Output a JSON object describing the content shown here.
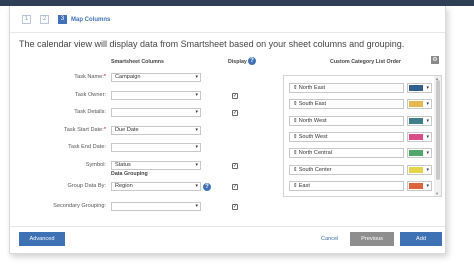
{
  "wizard": {
    "steps": [
      "1",
      "2",
      "3"
    ],
    "current_step_title": "Map Columns"
  },
  "intro_text": "The calendar view will display data from Smartsheet based on your sheet columns and grouping.",
  "columns_header": "Smartsheet Columns",
  "display_header": "Display",
  "category_header": "Custom Category List Order",
  "help_glyph": "?",
  "fields": [
    {
      "label": "Task Name:",
      "required": true,
      "value": "Campaign",
      "display": null
    },
    {
      "label": "Task Owner:",
      "required": false,
      "value": "",
      "display": true
    },
    {
      "label": "Task Details:",
      "required": false,
      "value": "",
      "display": true
    },
    {
      "label": "Task Start Date:",
      "required": true,
      "value": "Due Date",
      "display": null
    },
    {
      "label": "Task End Date:",
      "required": false,
      "value": "",
      "display": null
    },
    {
      "label": "Symbol:",
      "required": false,
      "value": "Status",
      "display": true
    }
  ],
  "data_grouping": {
    "title": "Data Grouping",
    "fields": [
      {
        "label": "Group Data By:",
        "value": "Region",
        "display": true,
        "help": true
      },
      {
        "label": "Secondary Grouping:",
        "value": "",
        "display": true,
        "help": false
      }
    ]
  },
  "categories": [
    {
      "name": "North East",
      "color": "#2f5f8a"
    },
    {
      "name": "South East",
      "color": "#e5b94e"
    },
    {
      "name": "North West",
      "color": "#3d7d8c"
    },
    {
      "name": "South West",
      "color": "#d94f8a"
    },
    {
      "name": "North Central",
      "color": "#4fa86a"
    },
    {
      "name": "South Center",
      "color": "#e3d44a"
    },
    {
      "name": "East",
      "color": "#e0623a"
    }
  ],
  "footer": {
    "advanced_label": "Advanced",
    "cancel_label": "Cancel",
    "previous_label": "Previous",
    "add_label": "Add"
  },
  "colors": {
    "accent": "#3f72b4",
    "header_bar": "#2f3f56",
    "secondary_button": "#8e8e8e"
  },
  "glyphs": {
    "caret": "▾",
    "check": "✓",
    "gear": "⚙",
    "drag": "⇕",
    "scroll_up": "▲",
    "scroll_down": "▼"
  }
}
